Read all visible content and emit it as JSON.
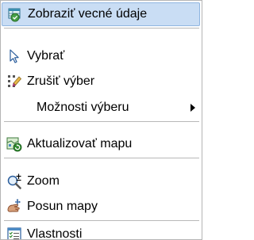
{
  "menu": {
    "items": [
      {
        "label": "Zobraziť vecné údaje",
        "icon": "table-view-icon",
        "highlighted": true
      },
      {
        "label": "Vybrať",
        "icon": "select-arrow-icon"
      },
      {
        "label": "Zrušiť výber",
        "icon": "clear-selection-icon"
      },
      {
        "label": "Možnosti výberu",
        "icon": "",
        "submenu": true
      },
      {
        "label": "Aktualizovať mapu",
        "icon": "refresh-map-icon"
      },
      {
        "label": "Zoom",
        "icon": "zoom-icon"
      },
      {
        "label": "Posun mapy",
        "icon": "pan-hand-icon"
      },
      {
        "label": "Vlastnosti",
        "icon": "properties-icon"
      }
    ]
  },
  "colors": {
    "highlight_bg": "#c9ddf4",
    "highlight_border": "#8fb5e0",
    "separator": "#b8b8b8"
  }
}
